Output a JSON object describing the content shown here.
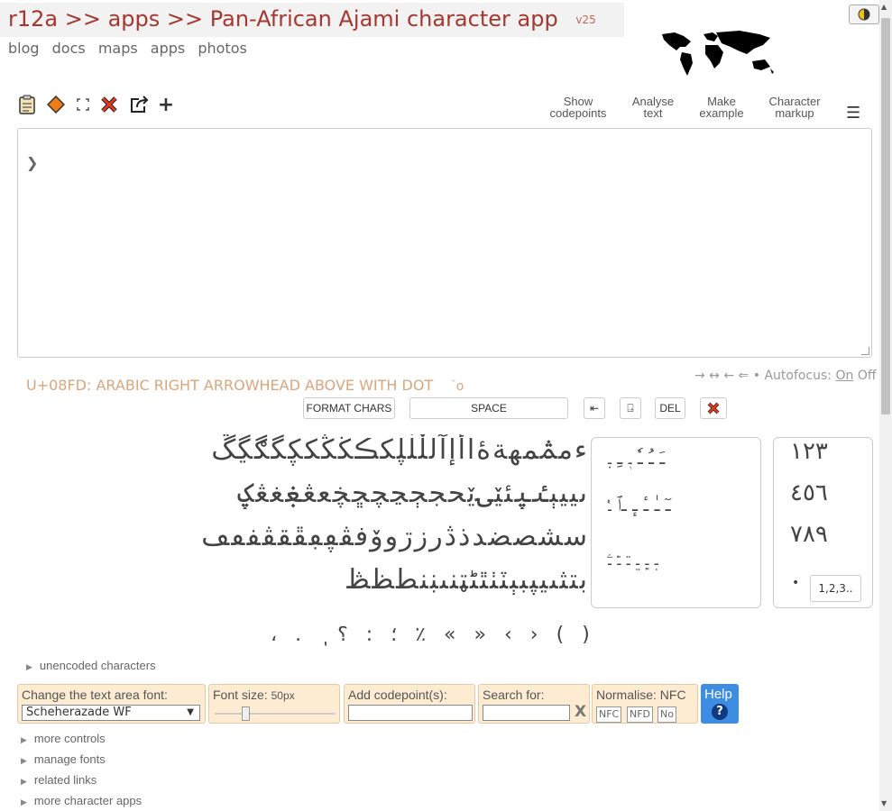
{
  "header": {
    "title": "r12a >> apps >> Pan-African Ajami character app",
    "version": "v25",
    "nav": [
      "blog",
      "docs",
      "maps",
      "apps",
      "photos"
    ]
  },
  "toolbar": {
    "icons": [
      "clipboard-icon",
      "diamond-icon",
      "fullscreen-icon",
      "clear-icon",
      "share-icon",
      "add-icon"
    ],
    "show_codepoints": [
      "Show",
      "codepoints"
    ],
    "analyse_text": [
      "Analyse",
      "text"
    ],
    "make_example": [
      "Make",
      "example"
    ],
    "character_markup": [
      "Character",
      "markup"
    ]
  },
  "textarea": {
    "caret": "❯"
  },
  "char_info": {
    "description": "U+08FD: ARABIC RIGHT ARROWHEAD ABOVE WITH DOT",
    "glyph": "ࣽ o"
  },
  "autofocus": {
    "arrows": "→ ↔ ← ⇐ •",
    "label": "Autofocus:",
    "on": "On",
    "off": "Off"
  },
  "buttons": {
    "format_chars": "FORMAT CHARS",
    "space": "SPACE",
    "ltr_mark": "⇤",
    "rtl_mark": "⍈",
    "del": "DEL"
  },
  "char_rows": [
    [
      "ء",
      "م",
      "ࢧ",
      "م",
      "ه",
      "ة",
      "ۀ",
      "ا",
      "أ",
      "إ",
      "آ",
      "ل",
      "ڵ",
      "ڶ",
      "ڸ",
      "ك",
      "ڪ",
      "ڬ",
      "ڭ",
      "ک",
      "ڮ",
      "گ",
      "ڰ",
      "ڲ",
      "ڴ"
    ],
    [
      "ى",
      "ی",
      "ي",
      "ې",
      "ٸ",
      "ۑ",
      "ئ",
      "ێ",
      "ۍ",
      "ێ",
      "ح",
      "ج",
      "ڄ",
      "ڃ",
      "چ",
      "ڇ",
      "ڿ",
      "ع",
      "ڠ",
      "ۼ",
      "غ",
      "ڠ",
      "ؼ"
    ],
    [
      "س",
      "ش",
      "ص",
      "ض",
      "د",
      "ذ",
      "ڎ",
      "ر",
      "ز",
      "ڗ",
      "و",
      "ۆ",
      "ف",
      "ڤ",
      "ڥ",
      "ڢ",
      "ڦ",
      "ق",
      "ڨ",
      "ڧ",
      "ٯ",
      "ڡ"
    ],
    [
      "ب",
      "ت",
      "ث",
      "ٮ",
      "ي",
      "پ",
      "ب",
      "ٻ",
      "ٽ",
      "ٺ",
      "ٿ",
      "ٹ",
      "ټ",
      "ن",
      "ں",
      "ڹ",
      "ن",
      "ط",
      "ظ",
      "ڟ"
    ]
  ],
  "diacritics_rows": [
    "ـَ ـُ ـٗ ـٖ ـِ ـٜ",
    "ـٓ ـٰ ـٔ ـٕ ـٱ ـٝ",
    "ـ࣭ ـ࣯ ـ࣮ ـ࣫ ـ࣬ ـۧ"
  ],
  "digits_rows": [
    "١٢٣",
    "٤٥٦",
    "٧٨٩"
  ],
  "digits_extra": {
    "bullet": "•",
    "button": "1,2,3.."
  },
  "punctuation": [
    "،",
    ".",
    "؛",
    ":",
    "؟",
    "ٖ",
    "٪",
    "«",
    "»",
    "‹",
    "›",
    "(",
    ")"
  ],
  "disclosures": {
    "unencoded": "unencoded characters",
    "more_controls": "more controls",
    "manage_fonts": "manage fonts",
    "related_links": "related links",
    "more_apps": "more character apps"
  },
  "controls": {
    "font_label": "Change the text area font:",
    "font_value": "Scheherazade WF",
    "font_size_label": "Font size:",
    "font_size_value": "50px",
    "add_codepoint_label": "Add codepoint(s):",
    "search_label": "Search for:",
    "search_clear": "X",
    "normalise_label": "Normalise: NFC",
    "normalise_options": [
      "NFC",
      "NFD",
      "No"
    ],
    "help_label": "Help",
    "help_icon": "?"
  },
  "font_size_slider_fraction": 0.25
}
